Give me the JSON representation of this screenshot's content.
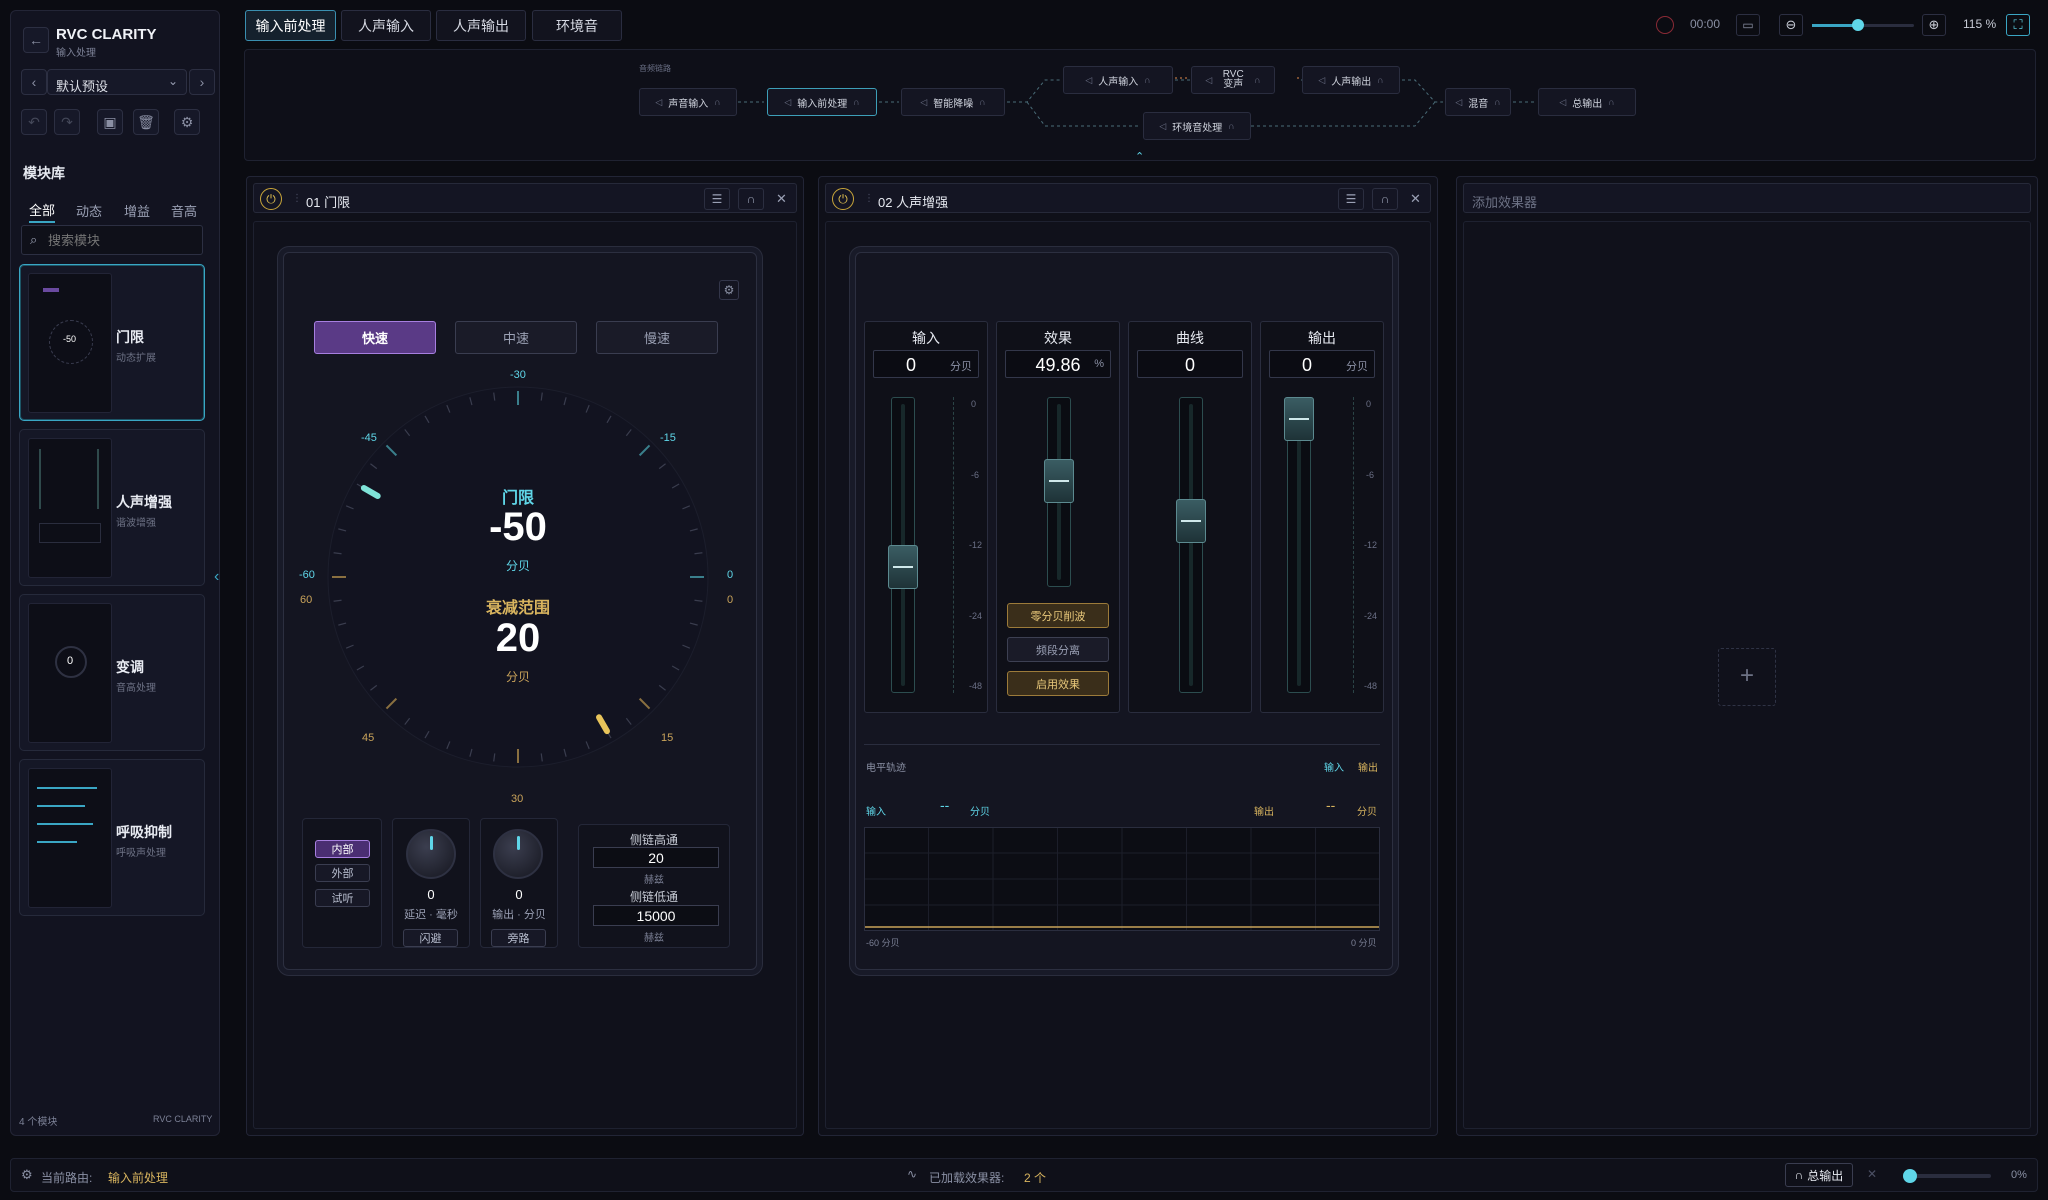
{
  "app": {
    "title": "RVC CLARITY",
    "subtitle": "输入处理"
  },
  "preset": {
    "name": "默认预设"
  },
  "library": {
    "title": "模块库",
    "tabs": [
      "全部",
      "动态",
      "增益",
      "音高"
    ],
    "search_placeholder": "搜索模块",
    "modules": [
      {
        "name": "门限",
        "desc": "动态扩展"
      },
      {
        "name": "人声增强",
        "desc": "谐波增强"
      },
      {
        "name": "变调",
        "desc": "音高处理"
      },
      {
        "name": "呼吸抑制",
        "desc": "呼吸声处理"
      }
    ],
    "footer_count": "4 个模块",
    "footer_brand": "RVC CLARITY"
  },
  "top_tabs": [
    "输入前处理",
    "人声输入",
    "人声输出",
    "环境音"
  ],
  "toolbar": {
    "time": "00:00",
    "zoom": "115 %",
    "volume_level": 0.45
  },
  "routing": {
    "label": "音频链路",
    "nodes": {
      "sound_input": "声音输入",
      "pre": "输入前处理",
      "denoise": "智能降噪",
      "vocal_in": "人声输入",
      "rvc": "RVC 变声",
      "vocal_out": "人声输出",
      "ambient": "环境音处理",
      "mix": "混音",
      "master": "总输出"
    }
  },
  "gate": {
    "title": "01 门限",
    "speeds": [
      "快速",
      "中速",
      "慢速"
    ],
    "threshold_label": "门限",
    "threshold_value": "-50",
    "threshold_unit": "分贝",
    "range_label": "衰减范围",
    "range_value": "20",
    "range_unit": "分贝",
    "dial_ticks": {
      "top": "-30",
      "ul": "-45",
      "ur": "-15",
      "left": "-60",
      "right": "0",
      "left2": "60",
      "right2": "0",
      "ll": "45",
      "lr": "15",
      "bottom": "30"
    },
    "sources": [
      "内部",
      "外部",
      "试听"
    ],
    "knob1": {
      "value": "0",
      "label": "延迟 · 毫秒",
      "button": "闪避"
    },
    "knob2": {
      "value": "0",
      "label": "输出 · 分贝",
      "button": "旁路"
    },
    "sidechain": {
      "hp_label": "侧链高通",
      "hp_value": "20",
      "hp_unit": "赫兹",
      "lp_label": "侧链低通",
      "lp_value": "15000",
      "lp_unit": "赫兹"
    }
  },
  "enhancer": {
    "title": "02 人声增强",
    "strips": [
      {
        "title": "输入",
        "value": "0",
        "unit": "分贝"
      },
      {
        "title": "效果",
        "value": "49.86",
        "unit": "%"
      },
      {
        "title": "曲线",
        "value": "0",
        "unit": ""
      },
      {
        "title": "输出",
        "value": "0",
        "unit": "分贝"
      }
    ],
    "fx_buttons": [
      "零分贝削波",
      "频段分离",
      "启用效果"
    ],
    "meter_scale": [
      "0",
      "-6",
      "-12",
      "-24",
      "-48"
    ],
    "trace": {
      "title": "电平轨迹",
      "legend_in": "输入",
      "legend_out": "输出",
      "in_label": "输入",
      "in_value": "--",
      "in_unit": "分贝",
      "out_label": "输出",
      "out_value": "--",
      "out_unit": "分贝",
      "axis_left": "-60 分贝",
      "axis_right": "0 分贝"
    }
  },
  "add_panel": {
    "title": "添加效果器"
  },
  "status": {
    "route_label": "当前路由:",
    "route_value": "输入前处理",
    "loaded_label": "已加载效果器:",
    "loaded_value": "2 个",
    "master_label": "总输出",
    "master_pct": "0%"
  }
}
